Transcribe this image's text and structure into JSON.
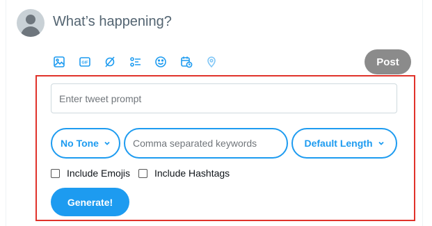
{
  "composer": {
    "placeholder": "What’s happening?",
    "post_label": "Post",
    "toolbar_icons": [
      "image-icon",
      "gif-icon",
      "grok-icon",
      "poll-icon",
      "emoji-icon",
      "schedule-icon",
      "location-icon"
    ]
  },
  "generator": {
    "prompt_placeholder": "Enter tweet prompt",
    "tone_label": "No Tone",
    "keywords_placeholder": "Comma separated keywords",
    "length_label": "Default Length",
    "include_emojis_label": "Include Emojis",
    "include_emojis_checked": false,
    "include_hashtags_label": "Include Hashtags",
    "include_hashtags_checked": false,
    "generate_label": "Generate!"
  },
  "colors": {
    "accent": "#1d9bf0",
    "panel_border": "#e0322a",
    "post_disabled": "#8b8b8b"
  }
}
